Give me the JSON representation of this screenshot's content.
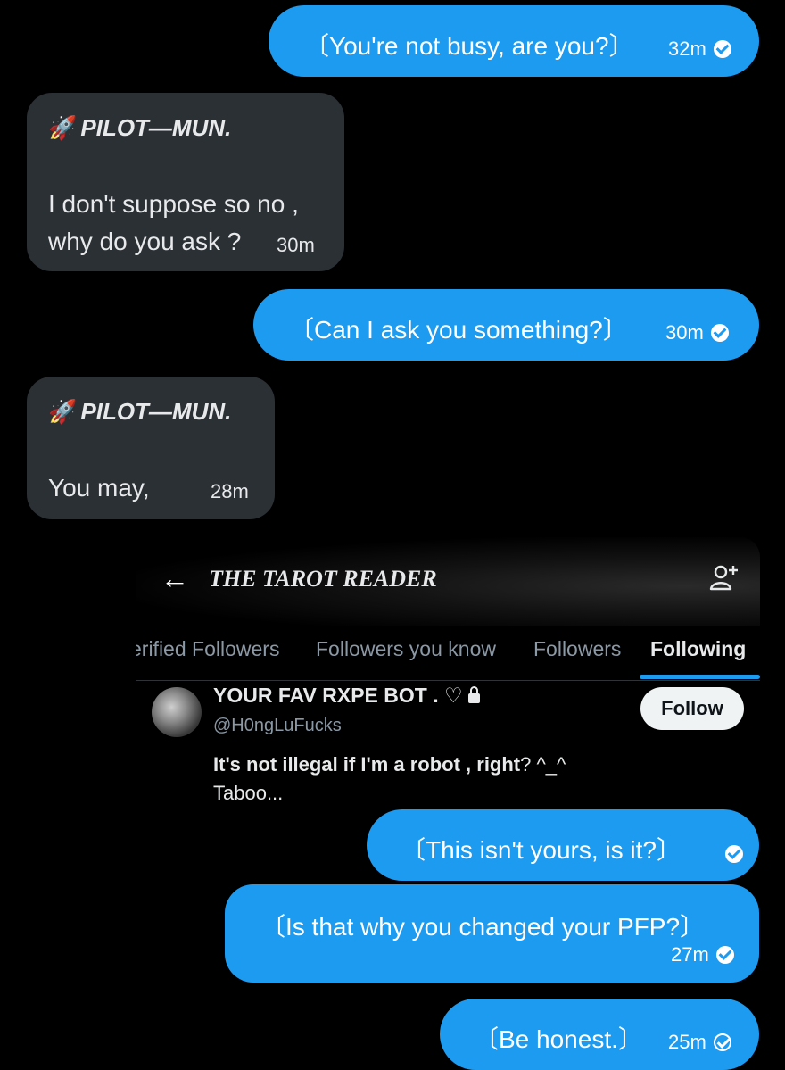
{
  "messages": [
    {
      "id": "m1",
      "type": "sent",
      "text": "〔You're not busy, are you?〕",
      "time": "32m",
      "status": "read"
    },
    {
      "id": "m2",
      "type": "received",
      "sender": "PILOT—MUN.",
      "sender_icon": "rocket-icon",
      "lines": [
        "I don't suppose so no ,",
        "why do you ask ?"
      ],
      "time": "30m"
    },
    {
      "id": "m3",
      "type": "sent",
      "text": "〔Can I ask you something?〕",
      "time": "30m",
      "status": "read"
    },
    {
      "id": "m4",
      "type": "received",
      "sender": "PILOT—MUN.",
      "sender_icon": "rocket-icon",
      "lines": [
        "You may,"
      ],
      "time": "28m"
    },
    {
      "id": "m6",
      "type": "sent",
      "text": "〔This isn't yours, is it?〕",
      "time": "",
      "status": "read"
    },
    {
      "id": "m7",
      "type": "sent",
      "text": "〔Is that why you changed your PFP?〕",
      "time": "27m",
      "status": "read"
    },
    {
      "id": "m8",
      "type": "sent",
      "text": "〔Be honest.〕",
      "time": "25m",
      "status": "sent"
    }
  ],
  "embedded_screenshot": {
    "title": "THE TAROT READER",
    "back_icon": "arrow-left-icon",
    "add_user_icon": "add-user-icon",
    "tabs": [
      "erified Followers",
      "Followers you know",
      "Followers",
      "Following"
    ],
    "active_tab": "Following",
    "user": {
      "display_name": "YOUR FAV RXPE BOT . ♡",
      "lock_icon": "lock-icon",
      "handle": "@H0ngLuFucks",
      "bio_bold": "It's not illegal if I'm a robot , right",
      "bio_tail": "? ^_^",
      "bio_line2": "Taboo...",
      "follow_label": "Follow"
    }
  },
  "colors": {
    "sent_bubble": "#1d9bf0",
    "received_bubble": "#2b3035",
    "background": "#000000"
  }
}
